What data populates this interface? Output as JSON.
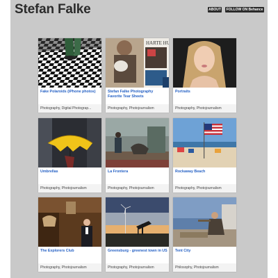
{
  "site": {
    "title": "Stefan Falke",
    "about_label": "ABOUT",
    "follow_label": "FOLLOW ON Behance"
  },
  "projects": [
    {
      "title": "Fake Polaroids (iPhone photos)",
      "meta": "Photography, Digital Photograp..."
    },
    {
      "title": "Stefan Falke Photography Favorite Tear Sheets",
      "meta": "Photography, Photojournalism"
    },
    {
      "title": "Portraits",
      "meta": "Photography, Photojournalism"
    },
    {
      "title": "Umbrellas",
      "meta": "Photography, Photojournalism"
    },
    {
      "title": "La Frontera",
      "meta": "Photography, Photojournalism"
    },
    {
      "title": "Rockaway Beach",
      "meta": "Photography, Photojournalism"
    },
    {
      "title": "The Explorers Club",
      "meta": "Photography, Photojournalism"
    },
    {
      "title": "Greensburg - greenest town in US",
      "meta": "Photography, Photojournalism"
    },
    {
      "title": "Tent City",
      "meta": "Philosophy, Photojournalism"
    }
  ],
  "thumb_text": {
    "tear_sheet": "HARTE HU"
  },
  "colors": {
    "background": "#c9c9c9",
    "link": "#2460c4",
    "button": "#2a2a2a"
  }
}
